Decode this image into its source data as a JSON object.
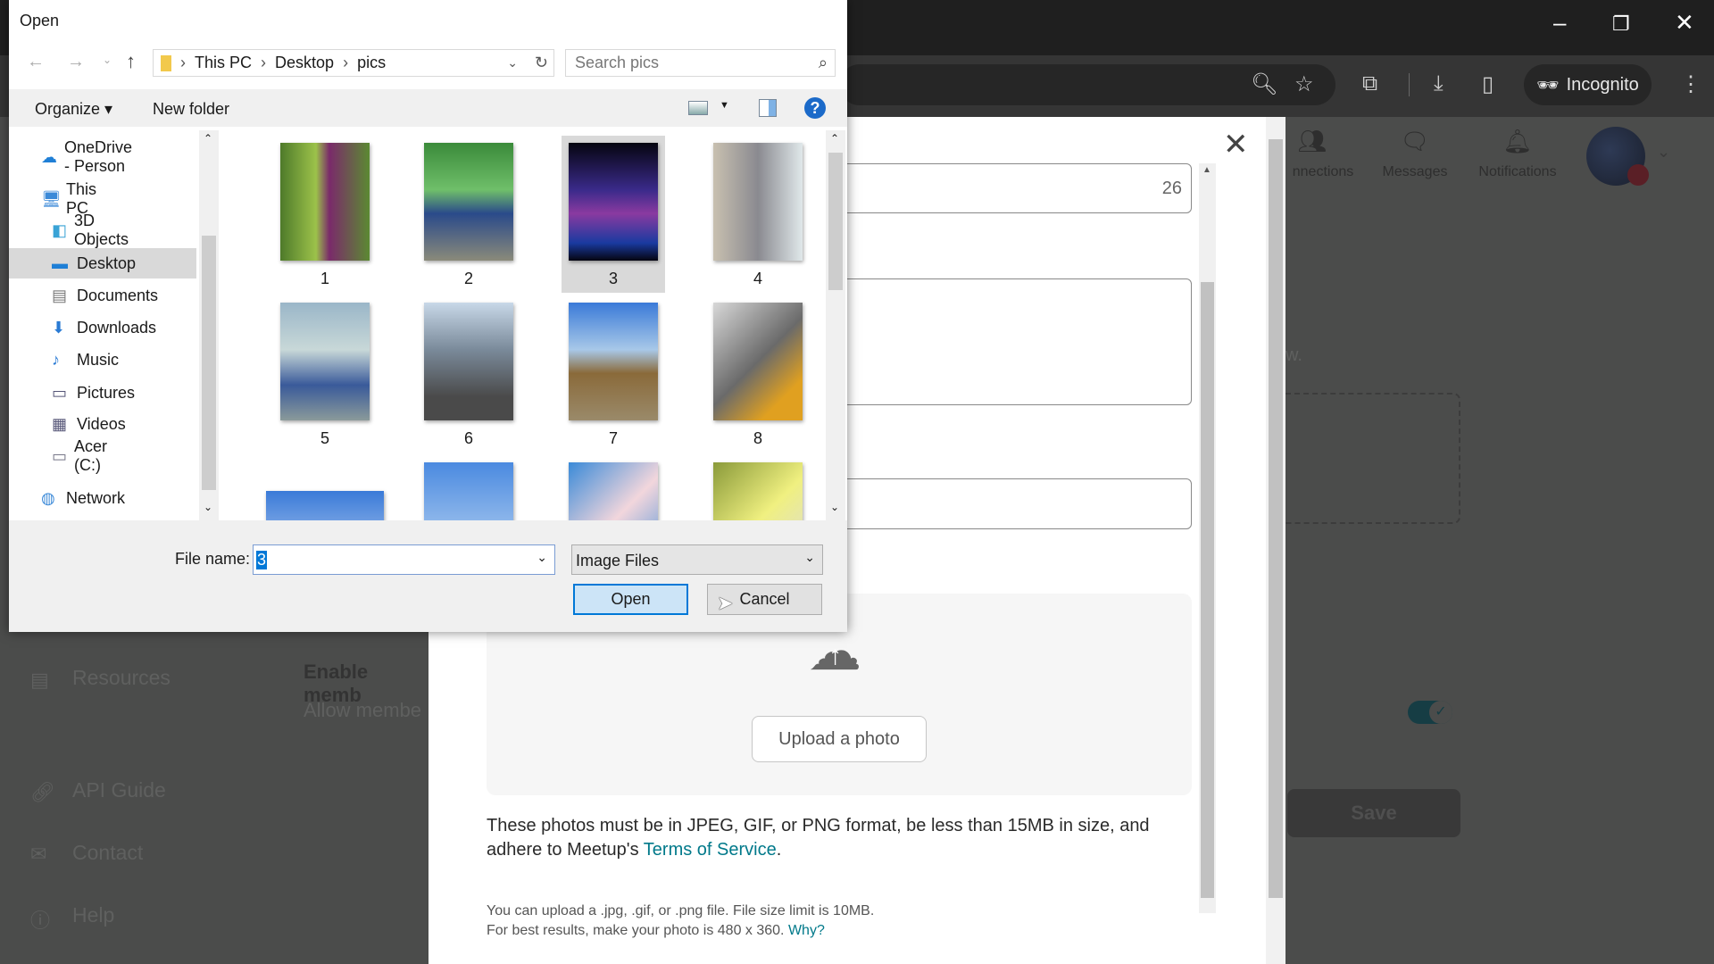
{
  "browser": {
    "window_controls": {
      "minimize": "–",
      "restore": "❐",
      "close": "✕"
    },
    "incognito_label": "Incognito"
  },
  "page": {
    "sidebar": [
      {
        "icon": "resources-icon",
        "label": "Resources"
      },
      {
        "icon": "link-icon",
        "label": "API Guide"
      },
      {
        "icon": "mail-icon",
        "label": "Contact"
      },
      {
        "icon": "info-icon",
        "label": "Help"
      }
    ],
    "setting_title": "Enable memb",
    "setting_desc": "Allow membe",
    "partial_text": "w.",
    "header": [
      {
        "label": "nnections",
        "icon": "connections-icon"
      },
      {
        "label": "Messages",
        "icon": "messages-icon"
      },
      {
        "label": "Notifications",
        "icon": "bell-icon"
      }
    ],
    "save_label": "Save",
    "toggle_on": true
  },
  "modal": {
    "counter": "26",
    "upload_button": "Upload a photo",
    "requirements_text": "These photos must be in JPEG, GIF, or PNG format, be less than 15MB in size, and adhere to Meetup's ",
    "terms_link": "Terms of Service",
    "period": ".",
    "hint_line1": "You can upload a .jpg, .gif, or .png file. File size limit is 10MB.",
    "hint_line2": "For best results, make your photo is 480 x 360. ",
    "why_link": "Why?"
  },
  "dialog": {
    "title": "Open",
    "breadcrumb": [
      "This PC",
      "Desktop",
      "pics"
    ],
    "search_placeholder": "Search pics",
    "organize": "Organize ▾",
    "new_folder": "New folder",
    "nav": [
      {
        "label": "OneDrive - Person",
        "icon": "onedrive-icon"
      },
      {
        "label": "This PC",
        "icon": "pc-icon"
      },
      {
        "label": "3D Objects",
        "icon": "3d-objects-icon"
      },
      {
        "label": "Desktop",
        "icon": "desktop-icon",
        "selected": true
      },
      {
        "label": "Documents",
        "icon": "documents-icon"
      },
      {
        "label": "Downloads",
        "icon": "downloads-icon"
      },
      {
        "label": "Music",
        "icon": "music-icon"
      },
      {
        "label": "Pictures",
        "icon": "pictures-icon"
      },
      {
        "label": "Videos",
        "icon": "videos-icon"
      },
      {
        "label": "Acer (C:)",
        "icon": "drive-icon"
      },
      {
        "label": "Network",
        "icon": "network-icon"
      }
    ],
    "files": [
      {
        "name": "1"
      },
      {
        "name": "2"
      },
      {
        "name": "3",
        "selected": true
      },
      {
        "name": "4"
      },
      {
        "name": "5"
      },
      {
        "name": "6"
      },
      {
        "name": "7"
      },
      {
        "name": "8"
      }
    ],
    "file_name_label": "File name:",
    "file_name_value": "3",
    "file_type": "Image Files",
    "open_label": "Open",
    "cancel_label": "Cancel"
  }
}
